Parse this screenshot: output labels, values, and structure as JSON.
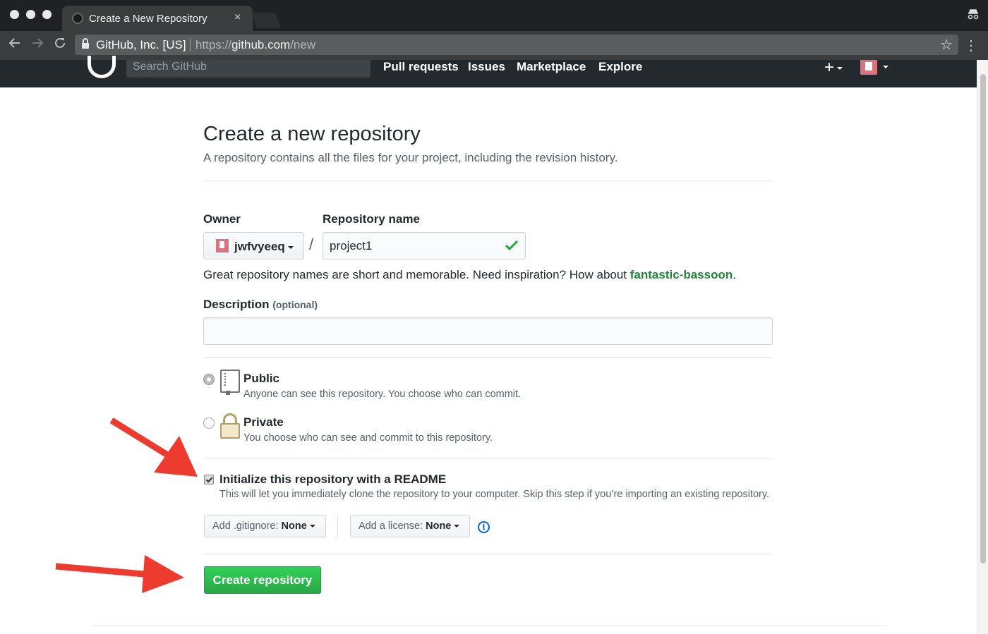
{
  "browser": {
    "tab_title": "Create a New Repository",
    "tab_close": "×",
    "site_identity": "GitHub, Inc. [US]",
    "url_scheme": "https://",
    "url_host": "github.com",
    "url_path": "/new",
    "icons": [
      "back-icon",
      "forward-icon",
      "reload-icon",
      "lock-icon",
      "star-icon",
      "menu-icon",
      "incognito-icon"
    ]
  },
  "header": {
    "search_placeholder": "Search GitHub",
    "nav": [
      "Pull requests",
      "Issues",
      "Marketplace",
      "Explore"
    ],
    "plus": "+"
  },
  "form": {
    "title": "Create a new repository",
    "subtitle": "A repository contains all the files for your project, including the revision history.",
    "owner_label": "Owner",
    "owner_value": "jwfvyeeq",
    "slash": "/",
    "repo_label": "Repository name",
    "repo_value": "project1",
    "hint_prefix": "Great repository names are short and memorable. Need inspiration? How about ",
    "hint_suggestion": "fantastic-bassoon",
    "hint_suffix": ".",
    "description_label": "Description",
    "description_optional": "(optional)",
    "description_value": "",
    "public_title": "Public",
    "public_desc": "Anyone can see this repository. You choose who can commit.",
    "private_title": "Private",
    "private_desc": "You choose who can see and commit to this repository.",
    "visibility_selected": "Public",
    "init_title": "Initialize this repository with a README",
    "init_desc": "This will let you immediately clone the repository to your computer. Skip this step if you’re importing an existing repository.",
    "init_checked": true,
    "gitignore_label": "Add .gitignore:",
    "gitignore_value": "None",
    "license_label": "Add a license:",
    "license_value": "None",
    "info": "i",
    "create_button": "Create repository"
  },
  "colors": {
    "header_bg": "#24292e",
    "create_green": "#2cbe4e",
    "suggestion_green": "#22863a",
    "annotation_red": "#ee3b2f",
    "avatar_pink": "#d8737f"
  }
}
